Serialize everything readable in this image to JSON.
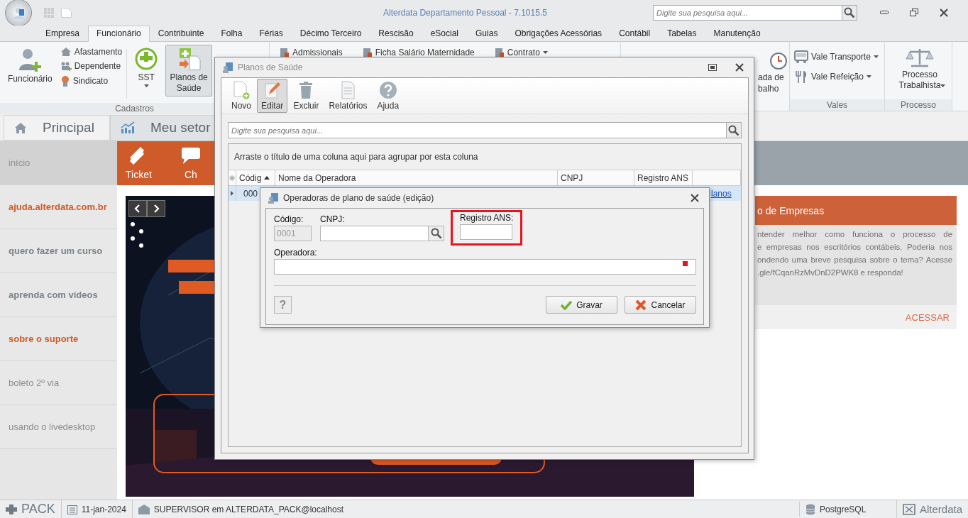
{
  "window": {
    "title": "Alterdata Departamento Pessoal - 7.1015.5",
    "search_placeholder": "Digite sua pesquisa aqui..."
  },
  "ribbon_tabs": [
    {
      "label": "Empresa",
      "selected": false
    },
    {
      "label": "Funcionário",
      "selected": true
    },
    {
      "label": "Contribuinte",
      "selected": false
    },
    {
      "label": "Folha",
      "selected": false
    },
    {
      "label": "Férias",
      "selected": false
    },
    {
      "label": "Décimo Terceiro",
      "selected": false
    },
    {
      "label": "Rescisão",
      "selected": false
    },
    {
      "label": "eSocial",
      "selected": false
    },
    {
      "label": "Guias",
      "selected": false
    },
    {
      "label": "Obrigações Acessórias",
      "selected": false
    },
    {
      "label": "Contábil",
      "selected": false
    },
    {
      "label": "Tabelas",
      "selected": false
    },
    {
      "label": "Manutenção",
      "selected": false
    }
  ],
  "cadastros": {
    "label": "Cadastros",
    "funcionario": "Funcionário",
    "small": [
      "Afastamento",
      "Dependente",
      "Sindicato"
    ],
    "sst": "SST",
    "planos": {
      "label": "Planos de Saúde",
      "selected": true
    }
  },
  "relatorios": [
    {
      "label": "Admissionais",
      "dropdown": false
    },
    {
      "label": "Ficha Salário Maternidade",
      "dropdown": false
    },
    {
      "label": "Contrato",
      "dropdown": true
    }
  ],
  "partial_button": "ada de balho",
  "vales": {
    "label": "Vales",
    "items": [
      "Vale Transporte",
      "Vale Refeição"
    ]
  },
  "processo": {
    "label": "Processo",
    "button": "Processo Trabalhista"
  },
  "page_tabs": [
    {
      "label": "Principal",
      "selected": true
    },
    {
      "label": "Meu setor",
      "selected": false
    }
  ],
  "sidebar": [
    {
      "label": "início",
      "kind": "plain",
      "selected": true
    },
    {
      "label": "ajuda.alterdata.com.br",
      "kind": "link",
      "selected": false
    },
    {
      "label": "quero fazer um curso",
      "kind": "bold",
      "selected": false
    },
    {
      "label": "aprenda com vídeos",
      "kind": "bold",
      "selected": false
    },
    {
      "label": "sobre o suporte",
      "kind": "link",
      "selected": false
    },
    {
      "label": "boleto 2º via",
      "kind": "plain",
      "selected": false
    },
    {
      "label": "usando o livedesktop",
      "kind": "plain",
      "selected": false
    }
  ],
  "action_bar": [
    "Ticket",
    "Ch"
  ],
  "card": {
    "title": "o de Empresas",
    "lines": [
      "ntender melhor como funciona o processo de",
      "e empresas nos escritórios contábeis. Poderia nos",
      "ondendo uma breve pesquisa sobre o tema? Acesse",
      ".gle/fCqanRzMvDnD2PWK8 e responda!"
    ],
    "action": "ACESSAR"
  },
  "status_bar": {
    "product": "PACK",
    "date": "11-jan-2024",
    "user": "SUPERVISOR em ALTERDATA_PACK@localhost",
    "database": "PostgreSQL",
    "brand": "Alterdata"
  },
  "planos_dialog": {
    "title": "Planos de Saúde",
    "toolbar": [
      {
        "label": "Novo",
        "selected": false
      },
      {
        "label": "Editar",
        "selected": true
      },
      {
        "label": "Excluir",
        "selected": false
      },
      {
        "label": "Relatórios",
        "selected": false
      },
      {
        "label": "Ajuda",
        "selected": false
      }
    ],
    "search_placeholder": "Digite sua pesquisa aqui...",
    "group_hint": "Arraste o título de uma coluna aqui para agrupar por esta coluna",
    "columns": [
      "Códig",
      "Nome da Operadora",
      "CNPJ",
      "Registro ANS"
    ],
    "rows": [
      {
        "code": "000",
        "link": "lanos",
        "selected": true
      }
    ]
  },
  "edit_dialog": {
    "title": "Operadoras de plano de saúde (edição)",
    "fields": [
      {
        "kind": "text",
        "label": "Código:",
        "value": "0001",
        "disabled": true,
        "highlighted": false,
        "required": false
      },
      {
        "kind": "lookup",
        "label": "CNPJ:",
        "disabled": false,
        "highlighted": false,
        "required": false
      },
      {
        "kind": "text",
        "label": "Registro ANS:",
        "disabled": false,
        "highlighted": true,
        "required": false
      },
      {
        "kind": "wide",
        "label": "Operadora:",
        "disabled": false,
        "highlighted": false,
        "required": true
      }
    ],
    "help": "?",
    "buttons": [
      "Gravar",
      "Cancelar"
    ]
  }
}
